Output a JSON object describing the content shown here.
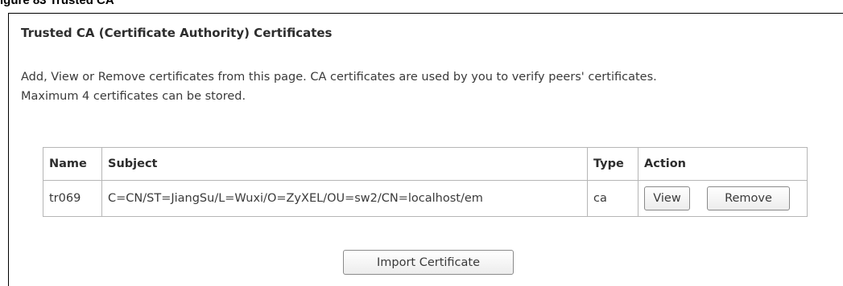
{
  "figure_label": "igure 83 Trusted CA",
  "page": {
    "title": "Trusted CA (Certificate Authority) Certificates",
    "description_line1": "Add, View or Remove certificates from this page. CA certificates are used by you to verify peers' certificates.",
    "description_line2": "Maximum 4 certificates can be stored."
  },
  "table": {
    "headers": {
      "name": "Name",
      "subject": "Subject",
      "type": "Type",
      "action": "Action"
    },
    "rows": [
      {
        "name": "tr069",
        "subject": "C=CN/ST=JiangSu/L=Wuxi/O=ZyXEL/OU=sw2/CN=localhost/em",
        "type": "ca",
        "view_label": "View",
        "remove_label": "Remove"
      }
    ]
  },
  "import_button_label": "Import Certificate"
}
